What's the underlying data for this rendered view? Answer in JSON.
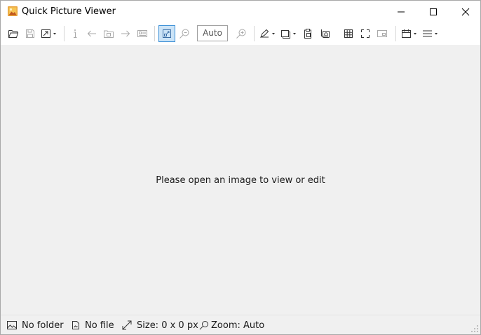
{
  "window": {
    "title": "Quick Picture Viewer",
    "controls": [
      "minimize-icon",
      "maximize-icon",
      "close-icon"
    ]
  },
  "toolbar": {
    "zoom_value": "Auto",
    "buttons": [
      "open-folder-icon",
      "save-icon",
      "open-with-icon",
      "info-icon",
      "previous-icon",
      "slideshow-icon",
      "next-icon",
      "exif-icon",
      "zoom-to-fit-icon",
      "zoom-out-icon",
      "zoom-in-icon",
      "draw-icon",
      "copy-icon",
      "paste-icon",
      "screenshot-icon",
      "grid-icon",
      "fullscreen-icon",
      "picture-in-picture-icon",
      "calendar-icon",
      "menu-icon"
    ],
    "active_button": "zoom-to-fit-icon"
  },
  "canvas": {
    "placeholder": "Please open an image to view or edit",
    "background": "#f0f0f0"
  },
  "statusbar": {
    "folder": "No folder",
    "file": "No file",
    "size": "Size: 0 x 0 px",
    "zoom": "Zoom: Auto"
  },
  "colors": {
    "accent": "#3b8fd6",
    "active_bg": "#cce4f7",
    "icon": "#333333",
    "icon_disabled": "#a8a8a8"
  }
}
